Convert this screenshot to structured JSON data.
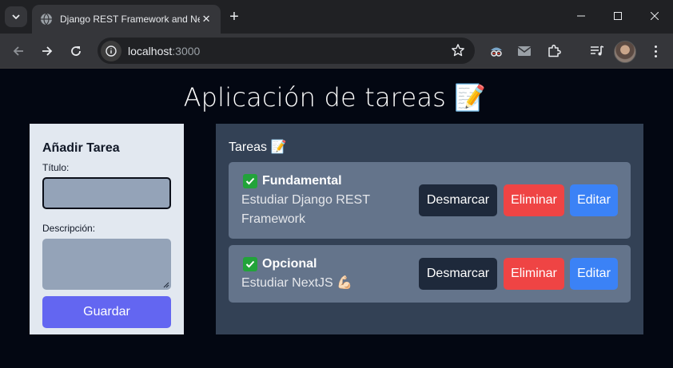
{
  "browser": {
    "tab_title": "Django REST Framework and Ne",
    "url_host": "localhost",
    "url_port": ":3000"
  },
  "app": {
    "title": "Aplicación de tareas 📝",
    "form": {
      "heading": "Añadir Tarea",
      "title_label": "Título:",
      "title_value": "",
      "description_label": "Descripción:",
      "description_value": "",
      "save_button": "Guardar"
    },
    "tasks_panel": {
      "heading": "Tareas 📝",
      "tasks": [
        {
          "name": "Fundamental",
          "description": "Estudiar Django REST Framework",
          "done": true,
          "unmark_button": "Desmarcar",
          "delete_button": "Eliminar",
          "edit_button": "Editar"
        },
        {
          "name": "Opcional",
          "description": "Estudiar NextJS 💪🏻",
          "done": true,
          "unmark_button": "Desmarcar",
          "delete_button": "Eliminar",
          "edit_button": "Editar"
        }
      ]
    }
  },
  "colors": {
    "page_bg": "#030712",
    "form_card_bg": "#e2e8f0",
    "tasks_card_bg": "#334155",
    "task_bg": "#64748b",
    "save_button": "#6366f1",
    "unmark_button": "#1e293b",
    "delete_button": "#ef4444",
    "edit_button": "#3b82f6",
    "check": "#22a33a"
  }
}
